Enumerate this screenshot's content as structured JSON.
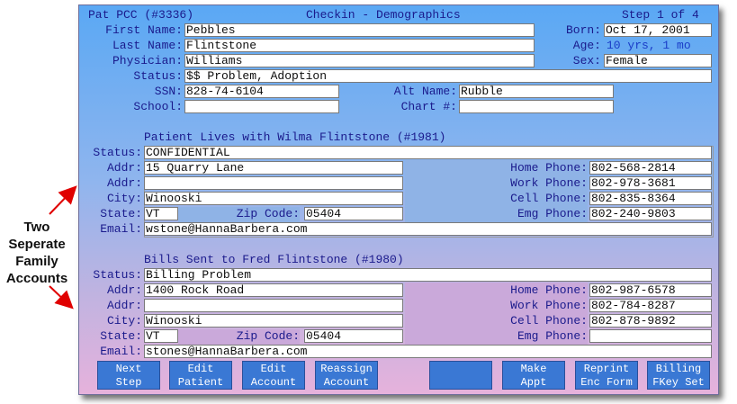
{
  "header": {
    "patient": "Pat PCC (#3336)",
    "title": "Checkin - Demographics",
    "step": "Step 1 of 4"
  },
  "patient": {
    "first_name_label": "First Name:",
    "first_name": "Pebbles",
    "last_name_label": "Last Name:",
    "last_name": "Flintstone",
    "physician_label": "Physician:",
    "physician": "Williams",
    "status_label": "Status:",
    "status": "$$ Problem, Adoption",
    "ssn_label": "SSN:",
    "ssn": "828-74-6104",
    "school_label": "School:",
    "school": "",
    "born_label": "Born:",
    "born": "Oct 17, 2001",
    "age_label": "Age:",
    "age": "10 yrs, 1 mo",
    "sex_label": "Sex:",
    "sex": "Female",
    "alt_name_label": "Alt Name:",
    "alt_name": "Rubble",
    "chart_label": "Chart #:",
    "chart": ""
  },
  "account1": {
    "title": "Patient Lives with Wilma Flintstone (#1981)",
    "status_label": "Status:",
    "status": "CONFIDENTIAL",
    "addr_label": "Addr:",
    "addr1": "15 Quarry Lane",
    "addr2": "",
    "city_label": "City:",
    "city": "Winooski",
    "state_label": "State:",
    "state": "VT",
    "zip_label": "Zip Code:",
    "zip": "05404",
    "email_label": "Email:",
    "email": "wstone@HannaBarbera.com",
    "home_phone_label": "Home Phone:",
    "home_phone": "802-568-2814",
    "work_phone_label": "Work Phone:",
    "work_phone": "802-978-3681",
    "cell_phone_label": "Cell Phone:",
    "cell_phone": "802-835-8364",
    "emg_phone_label": "Emg Phone:",
    "emg_phone": "802-240-9803"
  },
  "account2": {
    "title": "Bills Sent to Fred Flintstone (#1980)",
    "status_label": "Status:",
    "status": "Billing Problem",
    "addr_label": "Addr:",
    "addr1": "1400 Rock Road",
    "addr2": "",
    "city_label": "City:",
    "city": "Winooski",
    "state_label": "State:",
    "state": "VT",
    "zip_label": "Zip Code:",
    "zip": "05404",
    "email_label": "Email:",
    "email": "stones@HannaBarbera.com",
    "home_phone_label": "Home Phone:",
    "home_phone": "802-987-6578",
    "work_phone_label": "Work Phone:",
    "work_phone": "802-784-8287",
    "cell_phone_label": "Cell Phone:",
    "cell_phone": "802-878-9892",
    "emg_phone_label": "Emg Phone:",
    "emg_phone": ""
  },
  "buttons": [
    {
      "line1": "Next",
      "line2": "Step"
    },
    {
      "line1": "Edit",
      "line2": "Patient"
    },
    {
      "line1": "Edit",
      "line2": "Account"
    },
    {
      "line1": "Reassign",
      "line2": "Account"
    },
    {
      "line1": "",
      "line2": ""
    },
    {
      "line1": "Make",
      "line2": "Appt"
    },
    {
      "line1": "Reprint",
      "line2": "Enc Form"
    },
    {
      "line1": "Billing",
      "line2": "FKey Set"
    }
  ],
  "annotation": {
    "line1": "Two",
    "line2": "Seperate",
    "line3": "Family",
    "line4": "Accounts",
    "arrow_color": "#e00000"
  }
}
